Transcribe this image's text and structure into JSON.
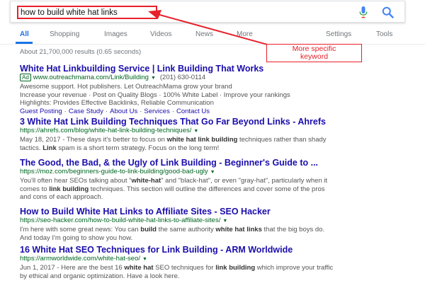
{
  "search": {
    "query": "how to build white hat links"
  },
  "tabs": [
    {
      "label": "All"
    },
    {
      "label": "Shopping"
    },
    {
      "label": "Images"
    },
    {
      "label": "Videos"
    },
    {
      "label": "News"
    },
    {
      "label": "More"
    },
    {
      "label": "Settings"
    },
    {
      "label": "Tools"
    }
  ],
  "result_stats": "About 21,700,000 results (0.65 seconds)",
  "annotation": {
    "line1": "More specific",
    "line2": "keyword",
    "color": "#e8202a"
  },
  "results": [
    {
      "title": "White Hat Linkbuilding Service | Link Building That Works",
      "ad_label": "Ad",
      "url": "www.outreachmama.com/Link/Building",
      "phone": "(201) 630-0114",
      "snippet_lines": [
        "Awesome support. Hot publishers. Let OutreachMama grow your brand",
        "Increase your revenue · Post on Quality Blogs · 100% White Label · Improve your rankings",
        "Highlights: Provides Effective Backlinks, Reliable Communication"
      ],
      "sitelinks": [
        "Guest Posting",
        "Case Study",
        "About Us",
        "Services",
        "Contact Us"
      ]
    },
    {
      "title": "3 White Hat Link Building Techniques That Go Far Beyond Links - Ahrefs",
      "url": "https://ahrefs.com/blog/white-hat-link-building-techniques/",
      "line1_pre": "May 18, 2017 - These days it's better to focus on ",
      "line1_bold": "white hat link building",
      "line1_post": " techniques rather than shady",
      "line2_pre": "tactics. ",
      "line2_bold": "Link",
      "line2_post": " spam is a short term strategy. Focus on the long term!"
    },
    {
      "title": "The Good, the Bad, & the Ugly of Link Building - Beginner's Guide to ...",
      "url": "https://moz.com/beginners-guide-to-link-building/good-bad-ugly",
      "line1_pre": "You'll often hear SEOs talking about \"",
      "line1_bold1": "white-hat",
      "line1_mid": "\" and \"black-hat\", or even \"gray-hat\", particularly when it",
      "line2_pre": "comes to ",
      "line2_bold": "link building",
      "line2_post": " techniques. This section will outline the differences and cover some of the pros",
      "line3": "and cons of each approach."
    },
    {
      "title": "How to Build White Hat Links to Affiliate Sites - SEO Hacker",
      "url": "https://seo-hacker.com/how-to-build-white-hat-links-to-affiliate-sites/",
      "line1_pre": "I'm here with some great news: You can ",
      "line1_bold1": "build",
      "line1_mid": " the same authority ",
      "line1_bold2": "white hat links",
      "line1_post": " that the big boys do.",
      "line2": "And today I'm going to show you how."
    },
    {
      "title": "16 White Hat SEO Techniques for Link Building - ARM Worldwide",
      "url": "https://armworldwide.com/white-hat-seo/",
      "line1_pre": "Jun 1, 2017 - Here are the best 16 ",
      "line1_bold1": "white hat",
      "line1_mid": " SEO techniques for ",
      "line1_bold2": "link building",
      "line1_post": " which improve your traffic",
      "line2": "by ethical and organic optimization. Have a look here."
    }
  ],
  "colors": {
    "link": "#1a0dab",
    "url": "#006621",
    "accent": "#1a73e8",
    "annotation": "#e8202a"
  },
  "icons": [
    "mic-icon",
    "search-icon",
    "arrow"
  ]
}
